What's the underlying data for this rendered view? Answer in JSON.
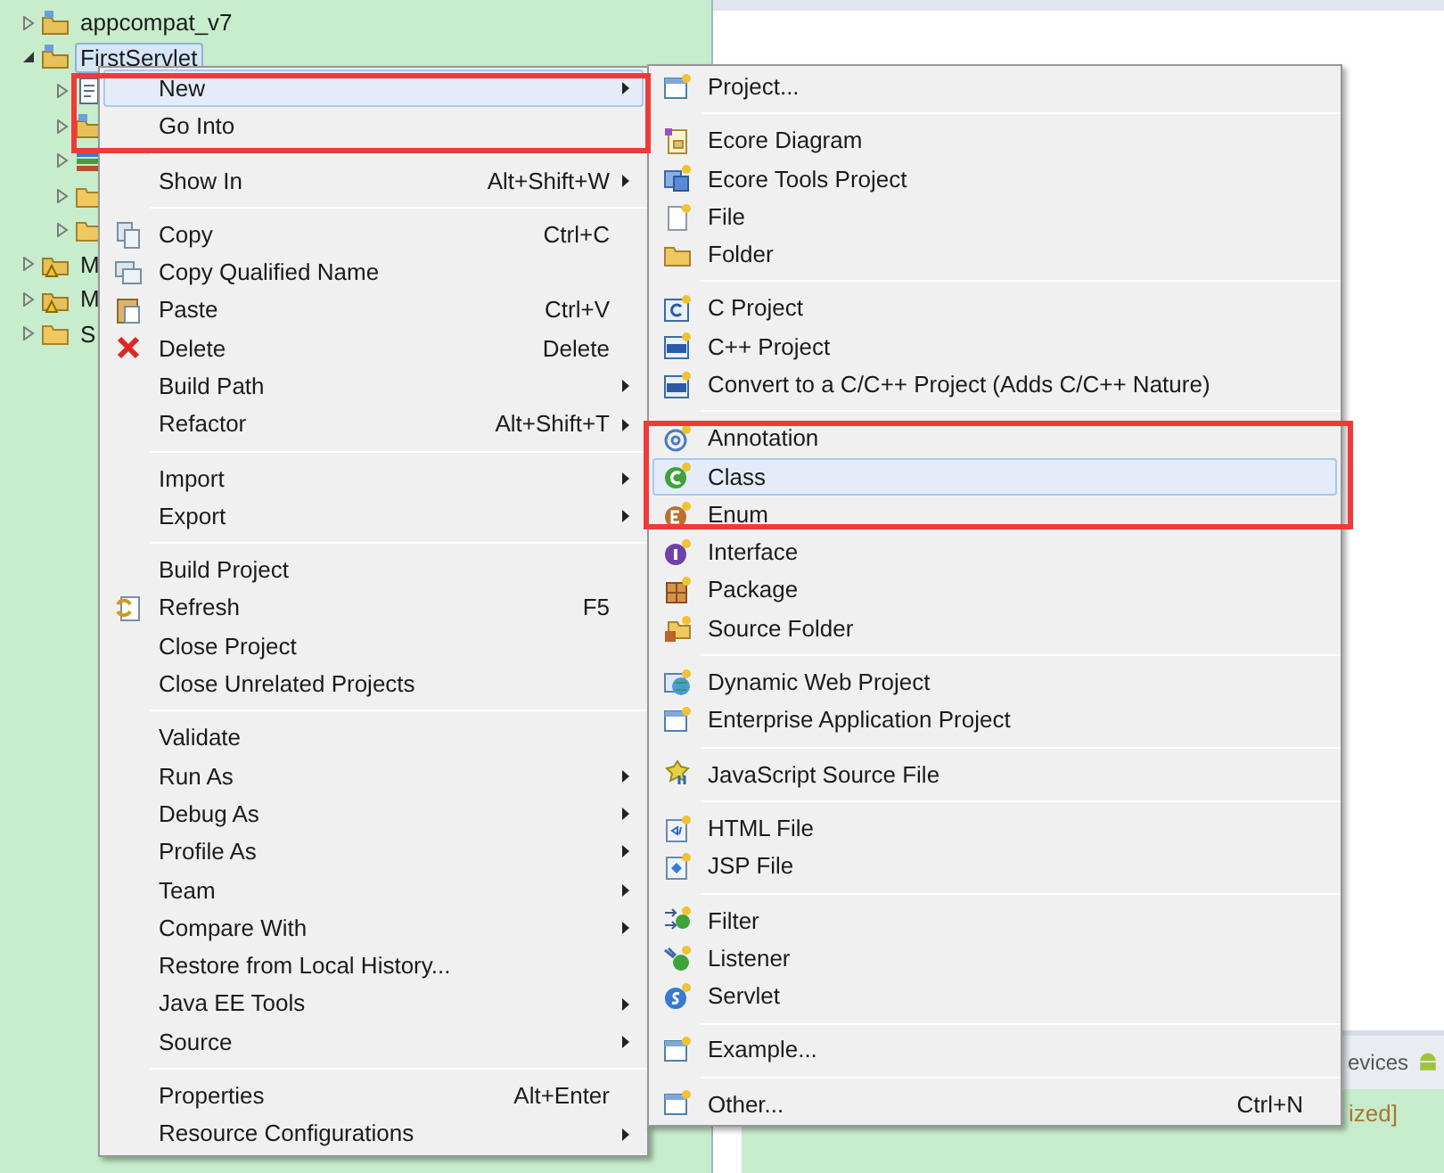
{
  "tree": [
    {
      "label": "appcompat_v7",
      "kind": "project",
      "expanded": false,
      "selected": false
    },
    {
      "label": "FirstServlet",
      "kind": "project",
      "expanded": true,
      "selected": true,
      "children": [
        {
          "kind": "descriptor",
          "expanded": false
        },
        {
          "kind": "project",
          "expanded": false
        },
        {
          "kind": "library",
          "expanded": false
        },
        {
          "kind": "folder",
          "expanded": false
        },
        {
          "kind": "folder",
          "expanded": false
        }
      ]
    },
    {
      "label": "M",
      "kind": "warning-project",
      "expanded": false,
      "selected": false
    },
    {
      "label": "M",
      "kind": "warning-project",
      "expanded": false,
      "selected": false
    },
    {
      "label": "S",
      "kind": "folder",
      "expanded": false,
      "selected": false
    }
  ],
  "context_menu": {
    "groups": [
      [
        {
          "label": "New",
          "submenu": true,
          "selected": true
        },
        {
          "label": "Go Into",
          "submenu": false,
          "selected": false
        }
      ],
      [
        {
          "label": "Show In",
          "shortcut": "Alt+Shift+W",
          "submenu": true,
          "selected": false
        }
      ],
      [
        {
          "label": "Copy",
          "kind": "copy",
          "shortcut": "Ctrl+C",
          "submenu": false,
          "selected": false
        },
        {
          "label": "Copy Qualified Name",
          "kind": "copy-name",
          "submenu": false,
          "selected": false
        },
        {
          "label": "Paste",
          "kind": "paste",
          "shortcut": "Ctrl+V",
          "submenu": false,
          "selected": false
        },
        {
          "label": "Delete",
          "kind": "delete",
          "shortcut": "Delete",
          "submenu": false,
          "selected": false
        },
        {
          "label": "Build Path",
          "submenu": true,
          "selected": false
        },
        {
          "label": "Refactor",
          "shortcut": "Alt+Shift+T",
          "submenu": true,
          "selected": false
        }
      ],
      [
        {
          "label": "Import",
          "submenu": true,
          "selected": false
        },
        {
          "label": "Export",
          "submenu": true,
          "selected": false
        }
      ],
      [
        {
          "label": "Build Project",
          "submenu": false,
          "selected": false
        },
        {
          "label": "Refresh",
          "kind": "refresh",
          "shortcut": "F5",
          "submenu": false,
          "selected": false
        },
        {
          "label": "Close Project",
          "submenu": false,
          "selected": false
        },
        {
          "label": "Close Unrelated Projects",
          "submenu": false,
          "selected": false
        }
      ],
      [
        {
          "label": "Validate",
          "submenu": false,
          "selected": false
        },
        {
          "label": "Run As",
          "submenu": true,
          "selected": false
        },
        {
          "label": "Debug As",
          "submenu": true,
          "selected": false
        },
        {
          "label": "Profile As",
          "submenu": true,
          "selected": false
        },
        {
          "label": "Team",
          "submenu": true,
          "selected": false
        },
        {
          "label": "Compare With",
          "submenu": true,
          "selected": false
        },
        {
          "label": "Restore from Local History...",
          "submenu": false,
          "selected": false
        },
        {
          "label": "Java EE Tools",
          "submenu": true,
          "selected": false
        },
        {
          "label": "Source",
          "submenu": true,
          "selected": false
        }
      ],
      [
        {
          "label": "Properties",
          "shortcut": "Alt+Enter",
          "submenu": false,
          "selected": false
        },
        {
          "label": "Resource Configurations",
          "submenu": true,
          "selected": false
        }
      ]
    ]
  },
  "new_submenu": {
    "groups": [
      [
        {
          "label": "Project...",
          "kind": "wizard",
          "selected": false
        }
      ],
      [
        {
          "label": "Ecore Diagram",
          "kind": "diagram",
          "selected": false
        },
        {
          "label": "Ecore Tools Project",
          "kind": "tools",
          "selected": false
        },
        {
          "label": "File",
          "kind": "file",
          "selected": false
        },
        {
          "label": "Folder",
          "kind": "folder",
          "selected": false
        }
      ],
      [
        {
          "label": "C Project",
          "kind": "c",
          "selected": false
        },
        {
          "label": "C++ Project",
          "kind": "cpp",
          "selected": false
        },
        {
          "label": "Convert to a C/C++ Project (Adds C/C++ Nature)",
          "kind": "cpp",
          "selected": false
        }
      ],
      [
        {
          "label": "Annotation",
          "kind": "annotation",
          "selected": false
        },
        {
          "label": "Class",
          "kind": "class",
          "selected": true
        },
        {
          "label": "Enum",
          "kind": "enum",
          "selected": false
        },
        {
          "label": "Interface",
          "kind": "interface",
          "selected": false
        },
        {
          "label": "Package",
          "kind": "package",
          "selected": false
        },
        {
          "label": "Source Folder",
          "kind": "package-folder",
          "selected": false
        }
      ],
      [
        {
          "label": "Dynamic Web Project",
          "kind": "globe",
          "selected": false
        },
        {
          "label": "Enterprise Application Project",
          "kind": "wizard",
          "selected": false
        }
      ],
      [
        {
          "label": "JavaScript Source File",
          "kind": "js",
          "selected": false
        }
      ],
      [
        {
          "label": "HTML File",
          "kind": "html",
          "selected": false
        },
        {
          "label": "JSP File",
          "kind": "jsp",
          "selected": false
        }
      ],
      [
        {
          "label": "Filter",
          "kind": "filter",
          "selected": false
        },
        {
          "label": "Listener",
          "kind": "listener",
          "selected": false
        },
        {
          "label": "Servlet",
          "kind": "servlet",
          "selected": false
        }
      ],
      [
        {
          "label": "Example...",
          "kind": "wizard",
          "selected": false
        }
      ],
      [
        {
          "label": "Other...",
          "kind": "wizard",
          "shortcut": "Ctrl+N",
          "selected": false
        }
      ]
    ]
  },
  "bottom_panel": {
    "tab": "evices",
    "server_status": "ized]"
  }
}
